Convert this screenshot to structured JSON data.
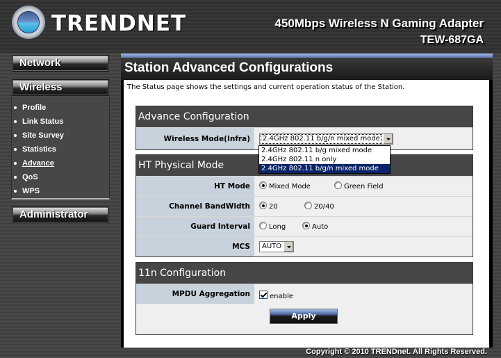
{
  "header": {
    "brand": "TRENDnet",
    "logo_text": "TRENDNET",
    "product_title": "450Mbps Wireless N Gaming Adapter",
    "product_model": "TEW-687GA"
  },
  "sidebar": {
    "network_label": "Network",
    "wireless_label": "Wireless",
    "administrator_label": "Administrator",
    "wireless_items": [
      {
        "label": "Profile",
        "active": false
      },
      {
        "label": "Link Status",
        "active": false
      },
      {
        "label": "Site Survey",
        "active": false
      },
      {
        "label": "Statistics",
        "active": false
      },
      {
        "label": "Advance",
        "active": true
      },
      {
        "label": "QoS",
        "active": false
      },
      {
        "label": "WPS",
        "active": false
      }
    ]
  },
  "main": {
    "title": "Station Advanced Configurations",
    "intro": "The Status page shows the settings and current operation status of the Station.",
    "advance_config": {
      "header": "Advance Configuration",
      "wireless_mode_label": "Wireless Mode(Infra)",
      "wireless_mode_value": "2.4GHz 802.11 b/g/n mixed mode",
      "wireless_mode_options": [
        "2.4GHz 802.11 b/g mixed mode",
        "2.4GHz 802.11 n only",
        "2.4GHz 802.11 b/g/n mixed mode"
      ],
      "wireless_mode_highlighted_index": 2
    },
    "ht_physical": {
      "header": "HT Physical Mode",
      "ht_mode_label": "HT Mode",
      "ht_mode_options": [
        "Mixed Mode",
        "Green Field"
      ],
      "ht_mode_selected": "Mixed Mode",
      "bandwidth_label": "Channel BandWidth",
      "bandwidth_options": [
        "20",
        "20/40"
      ],
      "bandwidth_selected": "20",
      "guard_label": "Guard Interval",
      "guard_options": [
        "Long",
        "Auto"
      ],
      "guard_selected": "Auto",
      "mcs_label": "MCS",
      "mcs_value": "AUTO"
    },
    "n11_config": {
      "header": "11n Configuration",
      "mpdu_label": "MPDU Aggregation",
      "mpdu_checkbox_label": "enable",
      "mpdu_enabled": true,
      "apply_label": "Apply"
    }
  },
  "footer": {
    "copyright": "Copyright © 2010 TRENDnet. All Rights Reserved."
  },
  "colors": {
    "section_header_bg": "#464646",
    "label_cell_bg": "#c8d2dc",
    "dropdown_highlight": "#0a246a",
    "accent_blue": "#5f78b0"
  }
}
